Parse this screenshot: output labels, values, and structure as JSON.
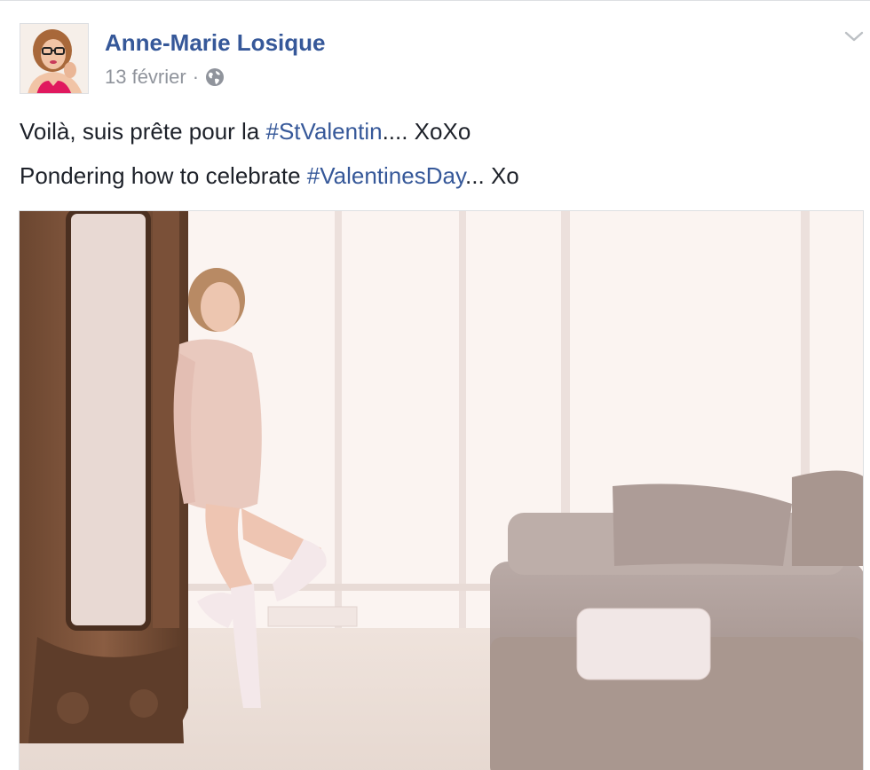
{
  "post": {
    "author_name": "Anne-Marie Losique",
    "date": "13 février",
    "separator": "·",
    "audience_icon": "globe-icon",
    "menu_icon": "chevron-down-icon",
    "text_line_1": {
      "before": "Voilà, suis prête pour la ",
      "hashtag": "#StValentin",
      "after": ".... XoXo"
    },
    "text_line_2": {
      "before": "Pondering how to celebrate ",
      "hashtag": "#ValentinesDay",
      "after": "... Xo"
    }
  },
  "colors": {
    "link": "#365899",
    "text": "#1d2129",
    "meta": "#90949c",
    "border": "#dddfe2"
  }
}
